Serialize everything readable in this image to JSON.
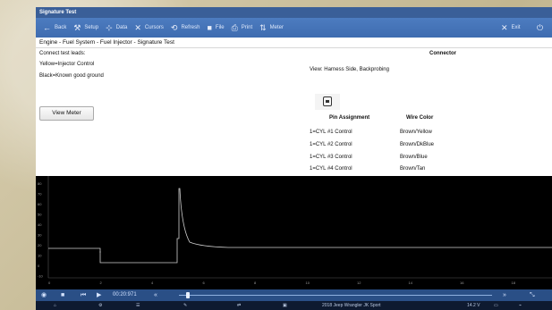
{
  "window": {
    "title": "Signature Test"
  },
  "toolbar": {
    "back": "Back",
    "setup": "Setup",
    "data": "Data",
    "cursors": "Cursors",
    "refresh": "Refresh",
    "file": "File",
    "print": "Print",
    "meter": "Meter",
    "exit": "Exit"
  },
  "panel": {
    "breadcrumb": "Engine - Fuel System - Fuel Injector - Signature Test",
    "leads_heading": "Connect test leads:",
    "lead_yellow": "Yellow=Injector Control",
    "lead_black": "Black=Known good ground",
    "view_meter": "View Meter",
    "connector_heading": "Connector",
    "view_text": "View: Harness Side, Backprobing",
    "col_pin": "Pin Assignment",
    "col_wire": "Wire Color",
    "rows": [
      {
        "pin": "1=CYL #1 Control",
        "wire": "Brown/Yellow"
      },
      {
        "pin": "1=CYL #2 Control",
        "wire": "Brown/DkBlue"
      },
      {
        "pin": "1=CYL #3 Control",
        "wire": "Brown/Blue"
      },
      {
        "pin": "1=CYL #4 Control",
        "wire": "Brown/Tan"
      }
    ]
  },
  "scope": {
    "y_ticks": [
      "80",
      "70",
      "60",
      "50",
      "40",
      "30",
      "20",
      "10",
      "0",
      "-10"
    ],
    "x_ticks": [
      "0",
      "2",
      "4",
      "6",
      "8",
      "10",
      "12",
      "14",
      "16",
      "18"
    ],
    "trace_color": "#d0d0d0"
  },
  "playback": {
    "time": "00:20:971"
  },
  "status": {
    "vehicle": "2018 Jeep Wrangler JK Sport",
    "voltage": "14.2 V"
  },
  "icons": {
    "back": "back-arrow-icon",
    "setup": "wrench-icon",
    "data": "gauge-icon",
    "cursors": "cursors-icon",
    "refresh": "refresh-icon",
    "file": "folder-icon",
    "print": "printer-icon",
    "meter": "meter-icon",
    "exit": "close-icon",
    "power": "power-icon"
  }
}
